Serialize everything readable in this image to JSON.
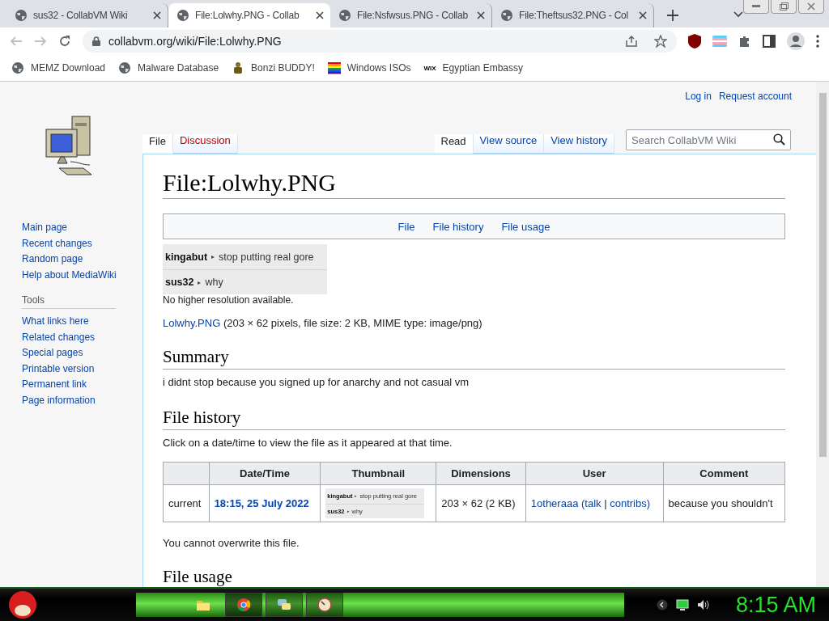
{
  "browser": {
    "tabs": [
      {
        "title": "sus32 - CollabVM Wiki",
        "selected": false
      },
      {
        "title": "File:Lolwhy.PNG - Collab",
        "selected": true
      },
      {
        "title": "File:Nsfwsus.PNG - Collab",
        "selected": false
      },
      {
        "title": "File:Theftsus32.PNG - Col",
        "selected": false
      }
    ],
    "address": "collabvm.org/wiki/File:Lolwhy.PNG",
    "bookmarks": [
      {
        "label": "MEMZ Download",
        "kind": "globe"
      },
      {
        "label": "Malware Database",
        "kind": "globe"
      },
      {
        "label": "Bonzi BUDDY!",
        "kind": "figure"
      },
      {
        "label": "Windows ISOs",
        "kind": "rainbow"
      },
      {
        "label": "Egyptian Embassy",
        "kind": "wordmark",
        "icon_text": "WIX"
      }
    ]
  },
  "wiki": {
    "personal": [
      "Log in",
      "Request account"
    ],
    "namespace_tabs": [
      {
        "label": "File",
        "selected": true
      },
      {
        "label": "Discussion",
        "selected": false
      }
    ],
    "view_tabs": [
      {
        "label": "Read",
        "selected": true
      },
      {
        "label": "View source",
        "selected": false
      },
      {
        "label": "View history",
        "selected": false
      }
    ],
    "search": {
      "placeholder": "Search CollabVM Wiki"
    },
    "sidebar": {
      "nav": [
        "Main page",
        "Recent changes",
        "Random page",
        "Help about MediaWiki"
      ],
      "tools_heading": "Tools",
      "tools": [
        "What links here",
        "Related changes",
        "Special pages",
        "Printable version",
        "Permanent link",
        "Page information"
      ]
    },
    "title": "File:Lolwhy.PNG",
    "file_menu": [
      "File",
      "File history",
      "File usage"
    ],
    "image": {
      "lines": [
        {
          "user": "kingabut",
          "arrow": "▸",
          "message": "stop putting real gore"
        },
        {
          "user": "sus32",
          "arrow": "▸",
          "message": "why"
        }
      ]
    },
    "no_higher": "No higher resolution available.",
    "file_info": {
      "link": "Lolwhy.PNG",
      "details": "(203 × 62 pixels, file size: 2 KB, MIME type: image/png)"
    },
    "summary_heading": "Summary",
    "summary": "i didnt stop because you signed up for anarchy and not casual vm",
    "history_heading": "File history",
    "history_note": "Click on a date/time to view the file as it appeared at that time.",
    "history_table": {
      "columns": [
        "Date/Time",
        "Thumbnail",
        "Dimensions",
        "User",
        "Comment"
      ],
      "rows": [
        {
          "status": "current",
          "date": "18:15, 25 July 2022",
          "thumbnail": {
            "lines": [
              {
                "user": "kingabut",
                "arrow": "▸",
                "message": "stop putting real gore"
              },
              {
                "user": "sus32",
                "arrow": "▸",
                "message": "why"
              }
            ]
          },
          "dimensions": "203 × 62 (2 KB)",
          "user": "1otheraaa",
          "open": "(",
          "talk": "talk",
          "sep": "|",
          "contribs": "contribs",
          "close": ")",
          "comment": "because you shouldn't"
        }
      ]
    },
    "overwrite_note": "You cannot overwrite this file.",
    "usage_heading": "File usage"
  },
  "taskbar": {
    "apps": [
      {
        "kind": "folder",
        "selected": false
      },
      {
        "kind": "browser",
        "selected": true
      },
      {
        "kind": "chat",
        "selected": false
      },
      {
        "kind": "clock",
        "selected": false
      }
    ],
    "clock": "8:15 AM"
  }
}
